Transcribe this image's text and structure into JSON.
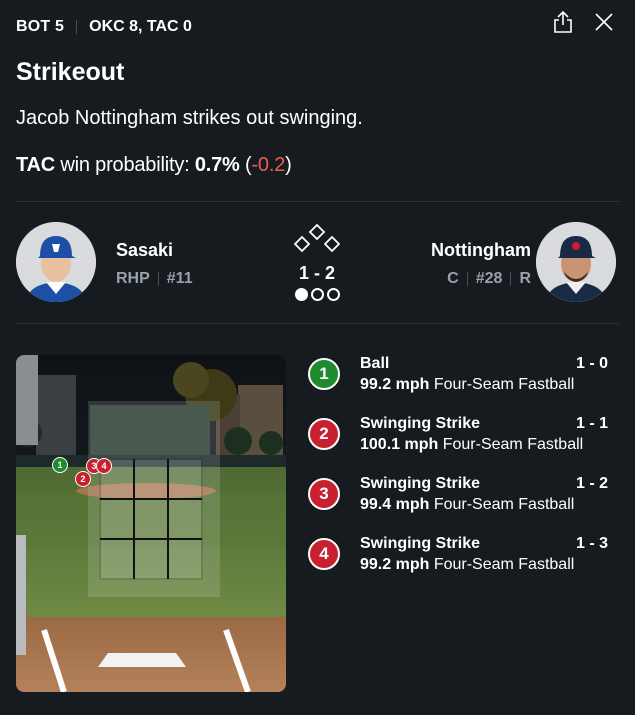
{
  "header": {
    "inning": "BOT 5",
    "score": "OKC 8, TAC 0",
    "share_icon": "share-icon",
    "close_icon": "close-icon"
  },
  "play": {
    "title": "Strikeout",
    "description": "Jacob Nottingham strikes out swinging."
  },
  "win_probability": {
    "team": "TAC",
    "label": "win probability:",
    "value": "0.7%",
    "open_paren": "(",
    "change": "-0.2",
    "close_paren": ")"
  },
  "pitcher": {
    "name": "Sasaki",
    "position": "RHP",
    "number": "#11"
  },
  "batter": {
    "name": "Nottingham",
    "position": "C",
    "number": "#28",
    "bats": "R"
  },
  "situation": {
    "count": "1 - 2",
    "outs": 1,
    "outs_total": 3
  },
  "pitches": [
    {
      "num": "1",
      "result": "Ball",
      "count": "1 - 0",
      "speed": "99.2 mph",
      "pitch_type": "Four-Seam Fastball",
      "color": "#1f8a2e"
    },
    {
      "num": "2",
      "result": "Swinging Strike",
      "count": "1 - 1",
      "speed": "100.1 mph",
      "pitch_type": "Four-Seam Fastball",
      "color": "#c8202e"
    },
    {
      "num": "3",
      "result": "Swinging Strike",
      "count": "1 - 2",
      "speed": "99.4 mph",
      "pitch_type": "Four-Seam Fastball",
      "color": "#c8202e"
    },
    {
      "num": "4",
      "result": "Swinging Strike",
      "count": "1 - 3",
      "speed": "99.2 mph",
      "pitch_type": "Four-Seam Fastball",
      "color": "#c8202e"
    }
  ],
  "colors": {
    "background": "#161b20",
    "negative": "#f05b4f",
    "ball": "#1f8a2e",
    "strike": "#c8202e"
  }
}
